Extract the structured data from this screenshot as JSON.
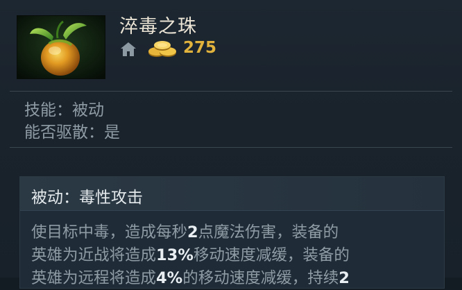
{
  "item": {
    "name": "淬毒之珠",
    "cost": "275",
    "icon": "poison-orb-icon"
  },
  "properties": [
    {
      "label": "技能：",
      "value": "被动"
    },
    {
      "label": "能否驱散：",
      "value": "是"
    }
  ],
  "ability": {
    "title": "被动：毒性攻击",
    "lines": [
      [
        "使目标中毒，造成每秒",
        "2",
        "点魔法伤害，装备的"
      ],
      [
        "英雄为近战将造成",
        "13%",
        "移动速度减缓，装备的"
      ],
      [
        "英雄为远程将造成",
        "4%",
        "的移动速度减缓，持续",
        "2"
      ]
    ]
  },
  "colors": {
    "background": "#1a232c",
    "gold": "#e2b33c",
    "highlight": "#e8eef2",
    "muted_text": "#8f9ca6"
  }
}
